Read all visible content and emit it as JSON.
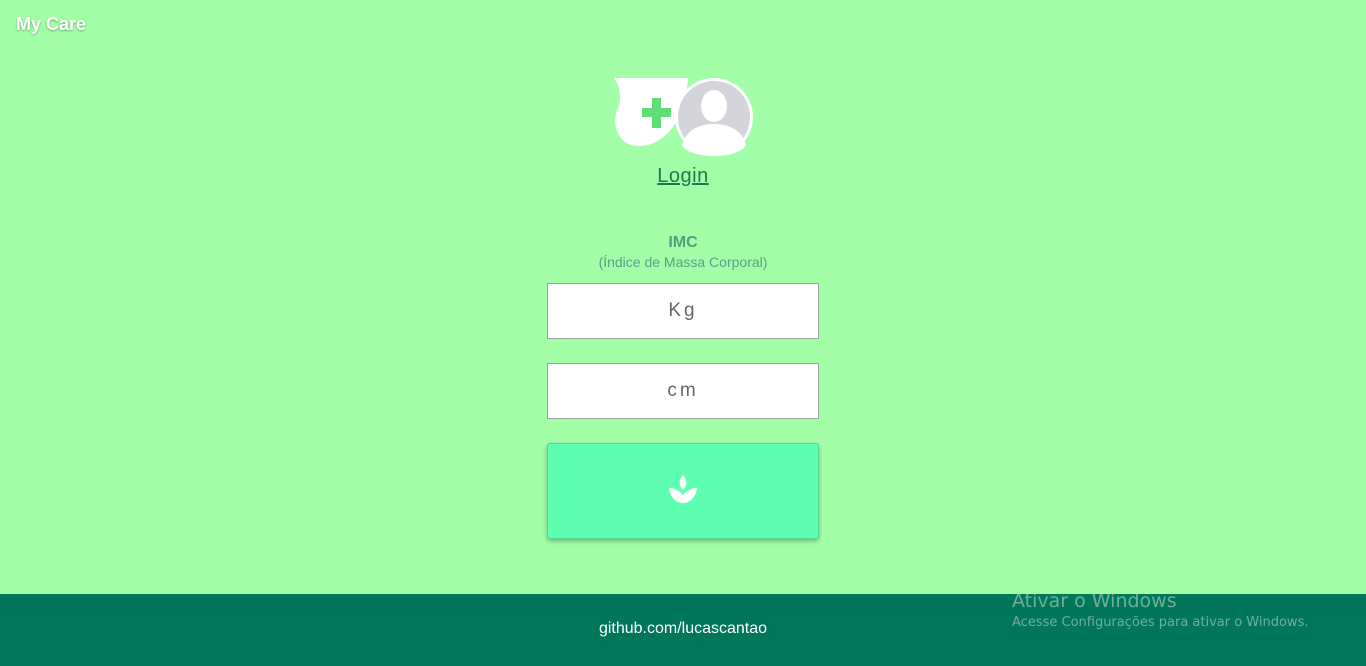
{
  "app": {
    "title": "My Care"
  },
  "header": {
    "login_label": "Login"
  },
  "form": {
    "title": "IMC",
    "subtitle": "(Índice de Massa Corporal)",
    "weight_placeholder": "Kg",
    "height_placeholder": "cm",
    "button_icon": "lotus-icon"
  },
  "footer": {
    "link_text": "github.com/lucascantao"
  },
  "watermark": {
    "title": "Ativar o Windows",
    "subtitle": "Acesse Configurações para ativar o Windows."
  },
  "colors": {
    "background": "#a2ffa8",
    "accent": "#5effb0",
    "footer": "#00765a",
    "link": "#1c7a4f"
  }
}
